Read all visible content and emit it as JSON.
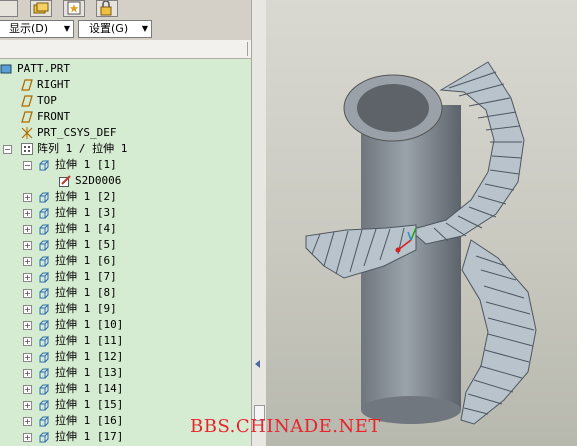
{
  "menus": {
    "display": "显示(D)",
    "settings": "设置(G)"
  },
  "tree": {
    "root": "PATT.PRT",
    "planes": [
      "RIGHT",
      "TOP",
      "FRONT"
    ],
    "csys": "PRT_CSYS_DEF",
    "pattern_label": "阵列 1 / 拉伸 1",
    "sketch_label": "S2D0006",
    "extrude_items": [
      "拉伸 1 [1]",
      "拉伸 1 [2]",
      "拉伸 1 [3]",
      "拉伸 1 [4]",
      "拉伸 1 [5]",
      "拉伸 1 [6]",
      "拉伸 1 [7]",
      "拉伸 1 [8]",
      "拉伸 1 [9]",
      "拉伸 1 [10]",
      "拉伸 1 [11]",
      "拉伸 1 [12]",
      "拉伸 1 [13]",
      "拉伸 1 [14]",
      "拉伸 1 [15]",
      "拉伸 1 [16]",
      "拉伸 1 [17]"
    ]
  },
  "watermark": "BBS.CHINADE.NET",
  "icons": [
    "toolbar-folder-icon",
    "toolbar-star-icon",
    "toolbar-lock-icon",
    "datum-plane-icon",
    "csys-icon",
    "pattern-icon",
    "extrude-icon",
    "sketch-icon"
  ],
  "colors": {
    "tree_bg": "#d6ecd2",
    "model_surface": "#8e959e",
    "step_surface": "#b8c3cc",
    "watermark": "#e8242a"
  }
}
